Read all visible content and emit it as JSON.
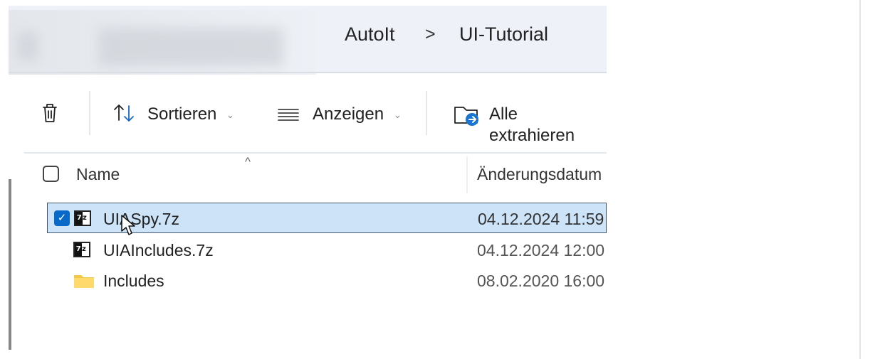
{
  "breadcrumb": {
    "items": [
      "AutoIt",
      "UI-Tutorial"
    ],
    "separator": ">"
  },
  "toolbar": {
    "delete_icon": "trash-icon",
    "sort_label": "Sortieren",
    "view_label": "Anzeigen",
    "extract_label": "Alle extrahieren",
    "extract_icon": "extract-folder-icon"
  },
  "table": {
    "columns": [
      "Name",
      "Änderungsdatum"
    ],
    "rows": [
      {
        "name": "UIASpy.7z",
        "date": "04.12.2024 11:59",
        "selected": true,
        "icon": "7z-archive-icon"
      },
      {
        "name": "UIAIncludes.7z",
        "date": "04.12.2024 12:00",
        "selected": false,
        "icon": "7z-archive-icon"
      },
      {
        "name": "Includes",
        "date": "08.02.2020 16:00",
        "selected": false,
        "icon": "folder-icon"
      }
    ]
  },
  "icons": {
    "seven_z_text": "7z",
    "checkmark": "✓",
    "sort_indicator": "^"
  },
  "colors": {
    "selection": "#cce3f8",
    "accent": "#0969c9",
    "folder": "#f2c84b"
  }
}
